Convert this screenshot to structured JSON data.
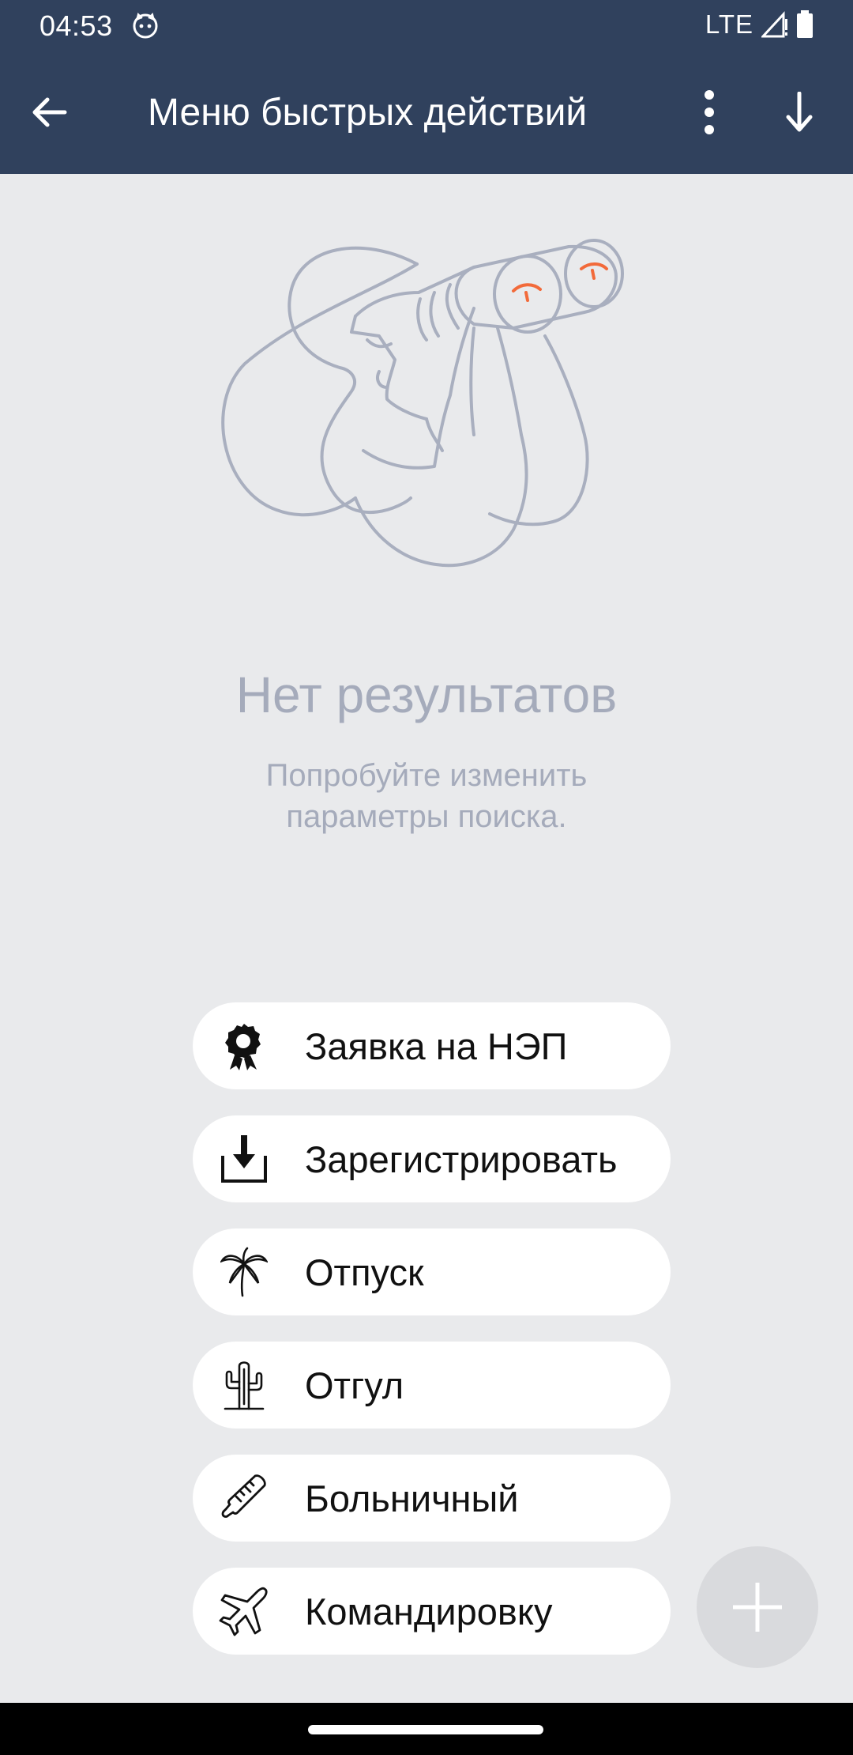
{
  "status_bar": {
    "time": "04:53",
    "network": "LTE"
  },
  "app_bar": {
    "title": "Меню быстрых действий",
    "back_icon": "arrow-left-icon",
    "more_icon": "more-vertical-icon",
    "download_icon": "arrow-down-icon"
  },
  "empty_state": {
    "title": "Нет результатов",
    "subtitle_line1": "Попробуйте изменить",
    "subtitle_line2": "параметры поиска."
  },
  "quick_actions": [
    {
      "label": "Заявка на НЭП",
      "icon": "award-icon"
    },
    {
      "label": "Зарегистрировать",
      "icon": "download-tray-icon"
    },
    {
      "label": "Отпуск",
      "icon": "palm-tree-icon"
    },
    {
      "label": "Отгул",
      "icon": "cactus-icon"
    },
    {
      "label": "Больничный",
      "icon": "thermometer-icon"
    },
    {
      "label": "Командировку",
      "icon": "airplane-icon"
    }
  ],
  "fab": {
    "icon": "plus-icon"
  },
  "colors": {
    "header": "#30415d",
    "background": "#e9eaec",
    "muted_text": "#a5abbb",
    "accent": "#f26a3a"
  }
}
